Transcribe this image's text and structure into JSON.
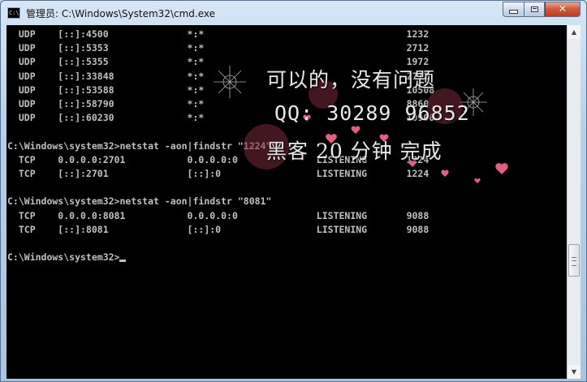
{
  "window": {
    "title": "管理员: C:\\Windows\\System32\\cmd.exe",
    "app_icon_text": "C:\\"
  },
  "console": {
    "lines": [
      "  UDP    [::]:4500              *:*                                    1232",
      "  UDP    [::]:5353              *:*                                    2712",
      "  UDP    [::]:5355              *:*                                    1972",
      "  UDP    [::]:33848             *:*                                    2712",
      "  UDP    [::]:53588             *:*                                    10508",
      "  UDP    [::]:58790             *:*                                    8860",
      "  UDP    [::]:60230             *:*                                    10900",
      "",
      "C:\\Windows\\system32>netstat -aon|findstr \"1224\"",
      "  TCP    0.0.0.0:2701           0.0.0.0:0              LISTENING       1224",
      "  TCP    [::]:2701              [::]:0                 LISTENING       1224",
      "",
      "C:\\Windows\\system32>netstat -aon|findstr \"8081\"",
      "  TCP    0.0.0.0:8081           0.0.0.0:0              LISTENING       9088",
      "  TCP    [::]:8081              [::]:0                 LISTENING       9088",
      "",
      "C:\\Windows\\system32>"
    ]
  },
  "watermark": {
    "line1": "可以的，没有问题",
    "line2": "QQ: 30289 96852",
    "line3": "黑客 20 分钟 完成"
  },
  "colors": {
    "console_bg": "#000000",
    "console_fg": "#c0c0c0",
    "close_button": "#c33a1b"
  }
}
